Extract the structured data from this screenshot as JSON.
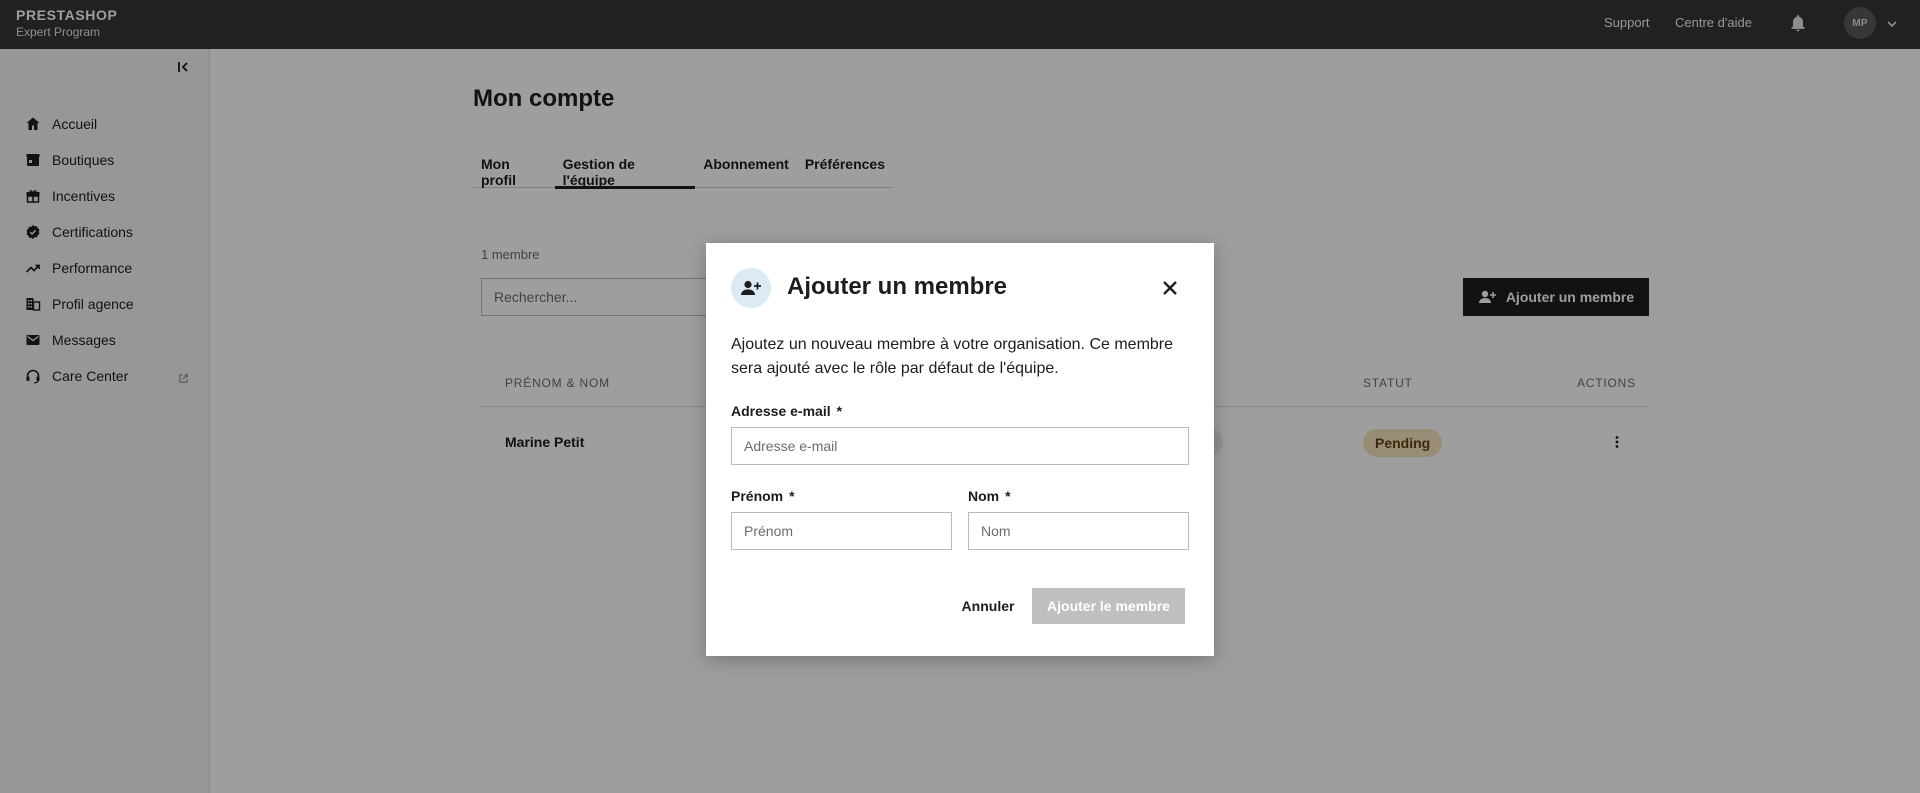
{
  "topbar": {
    "brand": "PRESTASHOP",
    "subtitle": "Expert Program",
    "links": [
      "Support",
      "Centre d'aide"
    ],
    "avatar_initials": "MP"
  },
  "sidebar": {
    "items": [
      {
        "label": "Accueil",
        "icon": "home-icon"
      },
      {
        "label": "Boutiques",
        "icon": "store-icon"
      },
      {
        "label": "Incentives",
        "icon": "gift-icon"
      },
      {
        "label": "Certifications",
        "icon": "badge-check-icon"
      },
      {
        "label": "Performance",
        "icon": "trending-up-icon"
      },
      {
        "label": "Profil agence",
        "icon": "building-icon"
      },
      {
        "label": "Messages",
        "icon": "mail-icon"
      },
      {
        "label": "Care Center",
        "icon": "headset-icon",
        "external": true
      }
    ]
  },
  "main": {
    "title": "Mon compte",
    "tabs": [
      {
        "label": "Mon profil",
        "active": false
      },
      {
        "label": "Gestion de l'équipe",
        "active": true
      },
      {
        "label": "Abonnement",
        "active": false
      },
      {
        "label": "Préférences",
        "active": false
      }
    ],
    "member_count": "1 membre",
    "search_placeholder": "Rechercher...",
    "add_member_label": "Ajouter un membre",
    "table": {
      "columns": [
        "PRÉNOM & NOM",
        "STATUT",
        "ACTIONS"
      ],
      "rows": [
        {
          "name": "Marine Petit",
          "status": "Pending"
        }
      ]
    }
  },
  "modal": {
    "title": "Ajouter un membre",
    "description": "Ajoutez un nouveau membre à votre organisation. Ce membre sera ajouté avec le rôle par défaut de l'équipe.",
    "email_label": "Adresse e-mail",
    "email_placeholder": "Adresse e-mail",
    "first_name_label": "Prénom",
    "first_name_placeholder": "Prénom",
    "last_name_label": "Nom",
    "last_name_placeholder": "Nom",
    "required_mark": "*",
    "cancel_label": "Annuler",
    "submit_label": "Ajouter le membre"
  },
  "colors": {
    "topbar": "#363636",
    "status_pending_bg": "#f5e2bd",
    "modal_icon_bg": "#dcebf3",
    "submit_disabled": "#bfbfbf"
  }
}
